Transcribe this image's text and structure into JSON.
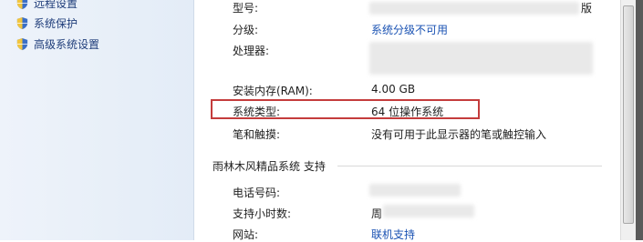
{
  "sidebar": {
    "items": [
      {
        "label": "远程设置",
        "icon": "shield-icon"
      },
      {
        "label": "系统保护",
        "icon": "shield-icon"
      },
      {
        "label": "高级系统设置",
        "icon": "shield-icon"
      }
    ]
  },
  "system": {
    "model_label": "型号:",
    "model_suffix": "版",
    "rating_label": "分级:",
    "rating_value": "系统分级不可用",
    "processor_label": "处理器:",
    "ram_label": "安装内存(RAM):",
    "ram_value": "4.00 GB",
    "type_label": "系统类型:",
    "type_value": "64 位操作系统",
    "pen_label": "笔和触摸:",
    "pen_value": "没有可用于此显示器的笔或触控输入"
  },
  "support": {
    "title": "雨林木风精品系统 支持",
    "phone_label": "电话号码:",
    "hours_label": "支持小时数:",
    "hours_value_prefix": "周",
    "website_label": "网站:",
    "website_value": "联机支持"
  },
  "colors": {
    "link": "#1a52b3",
    "highlight_border": "#c43c3c"
  }
}
